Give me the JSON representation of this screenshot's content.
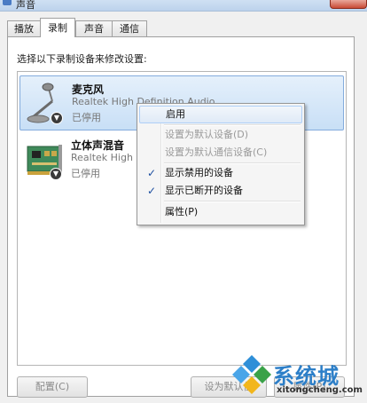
{
  "window": {
    "title": "声音"
  },
  "tabs": [
    {
      "label": "播放"
    },
    {
      "label": "录制"
    },
    {
      "label": "声音"
    },
    {
      "label": "通信"
    }
  ],
  "active_tab": "录制",
  "instruction": "选择以下录制设备来修改设置:",
  "devices": [
    {
      "name": "麦克风",
      "driver": "Realtek High Definition Audio",
      "status": "已停用",
      "icon": "microphone-icon",
      "selected": true
    },
    {
      "name": "立体声混音",
      "driver": "Realtek High D",
      "status": "已停用",
      "icon": "sound-card-icon",
      "selected": false
    }
  ],
  "context_menu": {
    "items": [
      {
        "label": "启用",
        "enabled": true,
        "checked": false,
        "hover": true
      },
      {
        "label": "设置为默认设备(D)",
        "enabled": false,
        "checked": false
      },
      {
        "label": "设置为默认通信设备(C)",
        "enabled": false,
        "checked": false
      },
      {
        "label": "显示禁用的设备",
        "enabled": true,
        "checked": true
      },
      {
        "label": "显示已断开的设备",
        "enabled": true,
        "checked": true
      },
      {
        "label": "属性(P)",
        "enabled": true,
        "checked": false
      }
    ]
  },
  "buttons": {
    "configure": "配置(C)",
    "set_default": "设为默认值",
    "properties": "属性(P)"
  },
  "watermark": {
    "title": "系统城",
    "url": "xitongcheng.com"
  },
  "colors": {
    "accent": "#1d4fa0",
    "selection": "#c8dff6",
    "watermark": "#2d7fc8"
  }
}
